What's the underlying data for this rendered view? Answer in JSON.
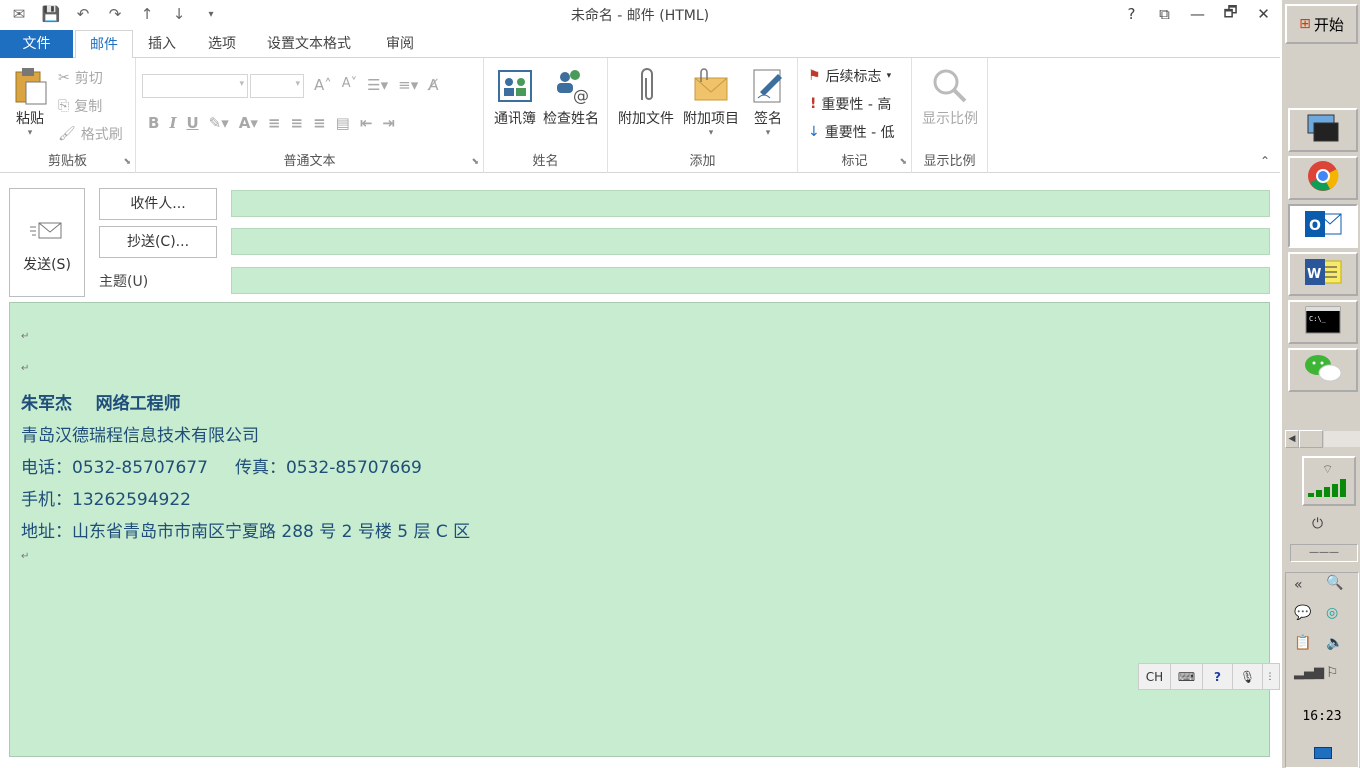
{
  "window": {
    "title": "未命名 - 邮件 (HTML)",
    "help": "?",
    "restore_ribbon": "⧉",
    "minimize": "—",
    "maximize": "🗗",
    "close": "✕"
  },
  "tabs": [
    "文件",
    "邮件",
    "插入",
    "选项",
    "设置文本格式",
    "审阅"
  ],
  "ribbon": {
    "clipboard": {
      "label": "剪贴板",
      "paste": "粘贴",
      "cut": "剪切",
      "copy": "复制",
      "format_painter": "格式刷"
    },
    "basic_text": {
      "label": "普通文本",
      "bold": "B",
      "italic": "I",
      "underline": "U"
    },
    "names": {
      "label": "姓名",
      "address_book": "通讯簿",
      "check_names": "检查姓名"
    },
    "include": {
      "label": "添加",
      "attach_file": "附加文件",
      "attach_item": "附加项目",
      "signature": "签名"
    },
    "tags": {
      "label": "标记",
      "follow_up": "后续标志",
      "high_importance": "重要性 - 高",
      "low_importance": "重要性 - 低"
    },
    "zoom": {
      "label": "显示比例",
      "zoom": "显示比例"
    }
  },
  "compose": {
    "send": "发送(S)",
    "to": "收件人...",
    "cc": "抄送(C)...",
    "subject": "主题(U)",
    "to_value": "",
    "cc_value": "",
    "subject_value": ""
  },
  "signature": {
    "name_title": "朱军杰    网络工程师",
    "company": "青岛汉德瑞程信息技术有限公司",
    "phone_fax": "电话：0532-85707677     传真：0532-85707669",
    "mobile": "手机：13262594922 ",
    "address": "地址：山东省青岛市市南区宁夏路 288 号 2 号楼 5 层 C 区",
    "paragraph_mark": "↵"
  },
  "ime": {
    "lang": "CH"
  },
  "taskbar": {
    "start": "开始",
    "clock": "16:23",
    "collapse": "«",
    "dashes": "———"
  },
  "colors": {
    "accent": "#1f6fc0",
    "body_bg": "#c8ecd0",
    "signature_text": "#1f4e79"
  }
}
